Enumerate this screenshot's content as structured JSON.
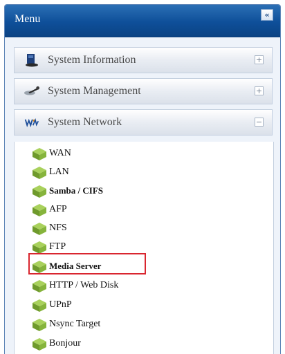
{
  "header": {
    "title": "Menu",
    "collapse_label": "«"
  },
  "sections": [
    {
      "label": "System Information",
      "toggle": "+",
      "icon": "system-information-icon"
    },
    {
      "label": "System Management",
      "toggle": "+",
      "icon": "system-management-icon"
    },
    {
      "label": "System Network",
      "toggle": "−",
      "icon": "system-network-icon"
    }
  ],
  "network_items": [
    {
      "label": "WAN"
    },
    {
      "label": "LAN"
    },
    {
      "label": "Samba / CIFS"
    },
    {
      "label": "AFP"
    },
    {
      "label": "NFS"
    },
    {
      "label": "FTP"
    },
    {
      "label": "Media Server"
    },
    {
      "label": "HTTP / Web Disk"
    },
    {
      "label": "UPnP"
    },
    {
      "label": "Nsync Target"
    },
    {
      "label": "Bonjour"
    }
  ],
  "highlighted_item": "Media Server",
  "colors": {
    "header": "#0e4f99",
    "highlight": "#d9262f",
    "item_icon": "#7fae3a"
  }
}
